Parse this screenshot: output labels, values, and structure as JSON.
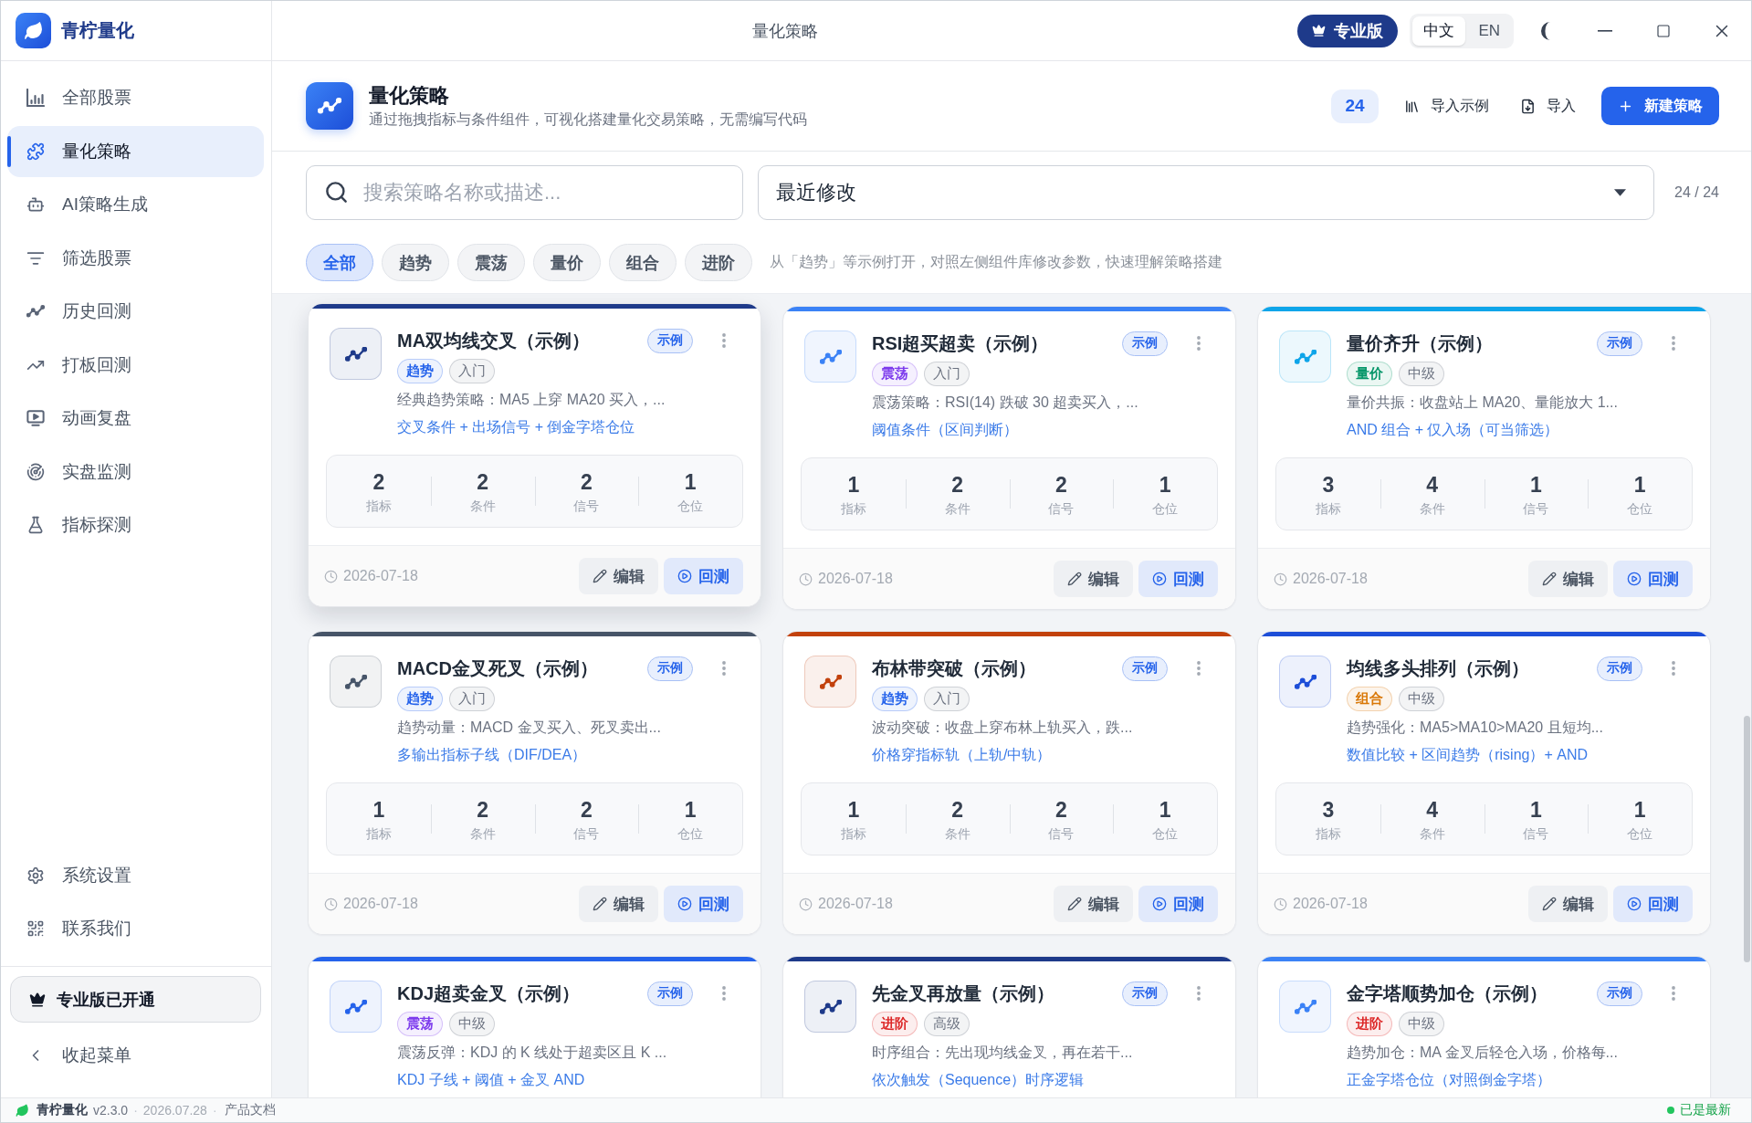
{
  "title_bar": {
    "app_name": "青柠量化",
    "title": "量化策略",
    "plan_badge": "专业版",
    "languages": [
      {
        "label": "中文",
        "selected": true
      },
      {
        "label": "EN",
        "selected": false
      }
    ]
  },
  "sidebar": {
    "items": [
      {
        "label": "全部股票",
        "selected": false
      },
      {
        "label": "量化策略",
        "selected": true
      },
      {
        "label": "AI策略生成",
        "selected": false
      },
      {
        "label": "筛选股票",
        "selected": false
      },
      {
        "label": "历史回测",
        "selected": false
      },
      {
        "label": "打板回测",
        "selected": false
      },
      {
        "label": "动画复盘",
        "selected": false
      },
      {
        "label": "实盘监测",
        "selected": false
      },
      {
        "label": "指标探测",
        "selected": false
      }
    ],
    "bottom_items": [
      {
        "label": "系统设置",
        "selected": false
      },
      {
        "label": "联系我们",
        "selected": false
      }
    ],
    "plan_status": "专业版已开通",
    "collapse": "收起菜单"
  },
  "page_header": {
    "title": "量化策略",
    "subtitle": "通过拖拽指标与条件组件，可视化搭建量化交易策略，无需编写代码",
    "count": "24",
    "buttons": [
      {
        "kind": "examples",
        "label": "导入示例"
      },
      {
        "kind": "import",
        "label": "导入"
      },
      {
        "kind": "create",
        "label": "新建策略"
      }
    ]
  },
  "toolbar": {
    "search": {
      "placeholder": "搜索策略名称或描述..."
    },
    "sort": {
      "value": "最近修改"
    },
    "result_count": "24 / 24"
  },
  "filters": {
    "chips": [
      {
        "label": "全部",
        "selected": true
      },
      {
        "label": "趋势",
        "selected": false
      },
      {
        "label": "震荡",
        "selected": false
      },
      {
        "label": "量价",
        "selected": false
      },
      {
        "label": "组合",
        "selected": false
      },
      {
        "label": "进阶",
        "selected": false
      }
    ],
    "hint": "从「趋势」等示例打开，对照左侧组件库修改参数，快速理解策略搭建"
  },
  "cards": [
    {
      "title": "MA双均线交叉（示例）",
      "badge": "示例",
      "color": "#1e3a8a",
      "hovered": true,
      "tags": [
        {
          "kind": "category",
          "label": "趋势",
          "color": "#2563eb"
        },
        {
          "kind": "level",
          "label": "入门",
          "color": "#6b7280"
        }
      ],
      "description": "经典趋势策略：MA5 上穿 MA20 买入，...",
      "summary": "交叉条件 + 出场信号 + 倒金字塔仓位",
      "stats": [
        {
          "value": "2",
          "label": "指标"
        },
        {
          "value": "2",
          "label": "条件"
        },
        {
          "value": "2",
          "label": "信号"
        },
        {
          "value": "1",
          "label": "仓位"
        }
      ],
      "date": "2026-07-18",
      "actions": [
        {
          "kind": "edit",
          "label": "编辑"
        },
        {
          "kind": "backtest",
          "label": "回测"
        }
      ]
    },
    {
      "title": "RSI超买超卖（示例）",
      "badge": "示例",
      "color": "#3b82f6",
      "hovered": false,
      "tags": [
        {
          "kind": "category",
          "label": "震荡",
          "color": "#7c3aed"
        },
        {
          "kind": "level",
          "label": "入门",
          "color": "#6b7280"
        }
      ],
      "description": "震荡策略：RSI(14) 跌破 30 超卖买入，...",
      "summary": "阈值条件（区间判断）",
      "stats": [
        {
          "value": "1",
          "label": "指标"
        },
        {
          "value": "2",
          "label": "条件"
        },
        {
          "value": "2",
          "label": "信号"
        },
        {
          "value": "1",
          "label": "仓位"
        }
      ],
      "date": "2026-07-18",
      "actions": [
        {
          "kind": "edit",
          "label": "编辑"
        },
        {
          "kind": "backtest",
          "label": "回测"
        }
      ]
    },
    {
      "title": "量价齐升（示例）",
      "badge": "示例",
      "color": "#0ea5e9",
      "hovered": false,
      "tags": [
        {
          "kind": "category",
          "label": "量价",
          "color": "#059669"
        },
        {
          "kind": "level",
          "label": "中级",
          "color": "#6b7280"
        }
      ],
      "description": "量价共振：收盘站上 MA20、量能放大 1...",
      "summary": "AND 组合 + 仅入场（可当筛选）",
      "stats": [
        {
          "value": "3",
          "label": "指标"
        },
        {
          "value": "4",
          "label": "条件"
        },
        {
          "value": "1",
          "label": "信号"
        },
        {
          "value": "1",
          "label": "仓位"
        }
      ],
      "date": "2026-07-18",
      "actions": [
        {
          "kind": "edit",
          "label": "编辑"
        },
        {
          "kind": "backtest",
          "label": "回测"
        }
      ]
    },
    {
      "title": "MACD金叉死叉（示例）",
      "badge": "示例",
      "color": "#475569",
      "hovered": false,
      "tags": [
        {
          "kind": "category",
          "label": "趋势",
          "color": "#2563eb"
        },
        {
          "kind": "level",
          "label": "入门",
          "color": "#6b7280"
        }
      ],
      "description": "趋势动量：MACD 金叉买入、死叉卖出...",
      "summary": "多输出指标子线（DIF/DEA）",
      "stats": [
        {
          "value": "1",
          "label": "指标"
        },
        {
          "value": "2",
          "label": "条件"
        },
        {
          "value": "2",
          "label": "信号"
        },
        {
          "value": "1",
          "label": "仓位"
        }
      ],
      "date": "2026-07-18",
      "actions": [
        {
          "kind": "edit",
          "label": "编辑"
        },
        {
          "kind": "backtest",
          "label": "回测"
        }
      ]
    },
    {
      "title": "布林带突破（示例）",
      "badge": "示例",
      "color": "#c2410c",
      "hovered": false,
      "tags": [
        {
          "kind": "category",
          "label": "趋势",
          "color": "#2563eb"
        },
        {
          "kind": "level",
          "label": "入门",
          "color": "#6b7280"
        }
      ],
      "description": "波动突破：收盘上穿布林上轨买入，跌...",
      "summary": "价格穿指标轨（上轨/中轨）",
      "stats": [
        {
          "value": "1",
          "label": "指标"
        },
        {
          "value": "2",
          "label": "条件"
        },
        {
          "value": "2",
          "label": "信号"
        },
        {
          "value": "1",
          "label": "仓位"
        }
      ],
      "date": "2026-07-18",
      "actions": [
        {
          "kind": "edit",
          "label": "编辑"
        },
        {
          "kind": "backtest",
          "label": "回测"
        }
      ]
    },
    {
      "title": "均线多头排列（示例）",
      "badge": "示例",
      "color": "#1d4ed8",
      "hovered": false,
      "tags": [
        {
          "kind": "category",
          "label": "组合",
          "color": "#d97706"
        },
        {
          "kind": "level",
          "label": "中级",
          "color": "#6b7280"
        }
      ],
      "description": "趋势强化：MA5>MA10>MA20 且短均...",
      "summary": "数值比较 + 区间趋势（rising）+ AND",
      "stats": [
        {
          "value": "3",
          "label": "指标"
        },
        {
          "value": "4",
          "label": "条件"
        },
        {
          "value": "1",
          "label": "信号"
        },
        {
          "value": "1",
          "label": "仓位"
        }
      ],
      "date": "2026-07-18",
      "actions": [
        {
          "kind": "edit",
          "label": "编辑"
        },
        {
          "kind": "backtest",
          "label": "回测"
        }
      ]
    },
    {
      "title": "KDJ超卖金叉（示例）",
      "badge": "示例",
      "color": "#2563eb",
      "hovered": false,
      "tags": [
        {
          "kind": "category",
          "label": "震荡",
          "color": "#7c3aed"
        },
        {
          "kind": "level",
          "label": "中级",
          "color": "#6b7280"
        }
      ],
      "description": "震荡反弹：KDJ 的 K 线处于超卖区且 K ...",
      "summary": "KDJ 子线 + 阈值 + 金叉 AND"
    },
    {
      "title": "先金叉再放量（示例）",
      "badge": "示例",
      "color": "#1e3a8a",
      "hovered": false,
      "tags": [
        {
          "kind": "category",
          "label": "进阶",
          "color": "#dc2626"
        },
        {
          "kind": "level",
          "label": "高级",
          "color": "#6b7280"
        }
      ],
      "description": "时序组合：先出现均线金叉，再在若干...",
      "summary": "依次触发（Sequence）时序逻辑"
    },
    {
      "title": "金字塔顺势加仓（示例）",
      "badge": "示例",
      "color": "#3b82f6",
      "hovered": false,
      "tags": [
        {
          "kind": "category",
          "label": "进阶",
          "color": "#dc2626"
        },
        {
          "kind": "level",
          "label": "中级",
          "color": "#6b7280"
        }
      ],
      "description": "趋势加仓：MA 金叉后轻仓入场，价格每...",
      "summary": "正金字塔仓位（对照倒金字塔）"
    }
  ],
  "status_bar": {
    "items": [
      {
        "kind": "brand",
        "text": "青柠量化"
      },
      {
        "kind": "version",
        "text": "v2.3.0"
      },
      {
        "kind": "separator",
        "text": "·"
      },
      {
        "kind": "date",
        "text": "2026.07.28"
      },
      {
        "kind": "separator",
        "text": "·"
      },
      {
        "kind": "link",
        "text": "产品文档"
      }
    ],
    "update_status": "已是最新"
  }
}
